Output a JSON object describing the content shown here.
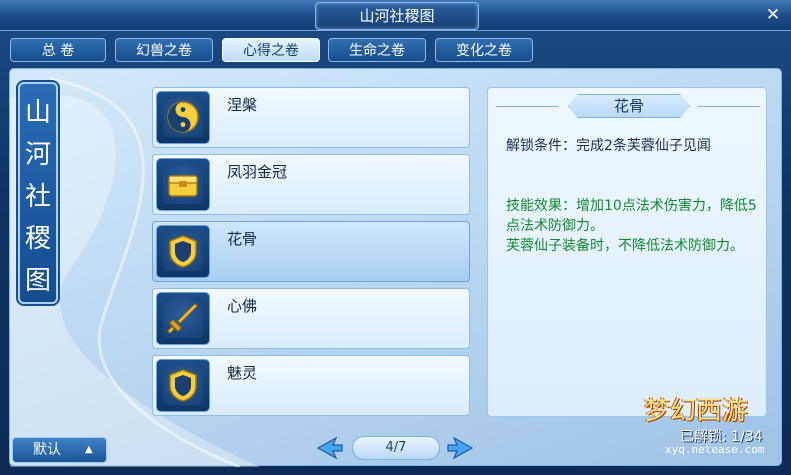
{
  "window": {
    "title": "山河社稷图",
    "close_label": "✕"
  },
  "tabs": [
    {
      "label": "总 卷",
      "active": false
    },
    {
      "label": "幻兽之卷",
      "active": false
    },
    {
      "label": "心得之卷",
      "active": true
    },
    {
      "label": "生命之卷",
      "active": false
    },
    {
      "label": "变化之卷",
      "active": false
    }
  ],
  "banner": {
    "text": [
      "山",
      "河",
      "社",
      "稷",
      "图"
    ]
  },
  "skills": [
    {
      "name": "涅槃",
      "icon": "yin-yang-icon",
      "selected": false
    },
    {
      "name": "凤羽金冠",
      "icon": "treasure-chest-icon",
      "selected": false
    },
    {
      "name": "花骨",
      "icon": "shield-icon",
      "selected": true
    },
    {
      "name": "心佛",
      "icon": "sword-icon",
      "selected": false
    },
    {
      "name": "魅灵",
      "icon": "shield-icon",
      "selected": false
    }
  ],
  "detail": {
    "title": "花骨",
    "unlock": "解锁条件：完成2条芙蓉仙子见闻",
    "effect_lines": [
      "技能效果：增加10点法术伤害力，降低5点法术防御力。",
      "芙蓉仙子装备时，不降低法术防御力。"
    ]
  },
  "bottom": {
    "sort_label": "默认",
    "sort_caret": "▲",
    "page": "4/7"
  },
  "logo": {
    "name": "梦幻西游",
    "count": "已解锁: 1/34",
    "url": "xyq.netease.com"
  },
  "colors": {
    "accent_gold": "#f2c12e",
    "effect_green": "#138a2c"
  }
}
